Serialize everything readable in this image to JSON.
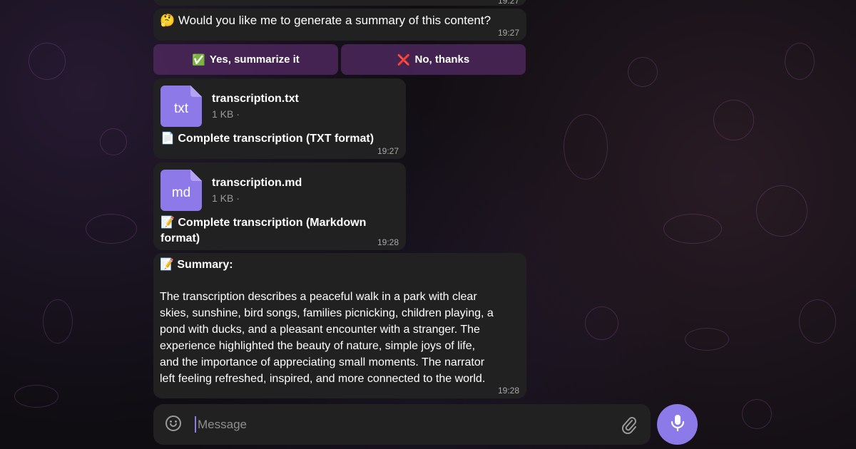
{
  "top_partial": {
    "time": "19:27"
  },
  "question": {
    "emoji": "🤔",
    "text": "Would you like me to generate a summary of this content?",
    "time": "19:27"
  },
  "buttons": {
    "yes": {
      "emoji": "✅",
      "label": "Yes, summarize it"
    },
    "no": {
      "emoji": "❌",
      "label": "No, thanks"
    }
  },
  "files": [
    {
      "ext": "txt",
      "name": "transcription.txt",
      "size": "1 KB ·",
      "caption_emoji": "📄",
      "caption": "Complete transcription (TXT format)",
      "time": "19:27"
    },
    {
      "ext": "md",
      "name": "transcription.md",
      "size": "1 KB ·",
      "caption_emoji": "📝",
      "caption_line1": "Complete transcription (Markdown",
      "caption_line2": "format)",
      "time": "19:28"
    }
  ],
  "summary": {
    "emoji": "📝",
    "heading": "Summary:",
    "lines": [
      "The transcription describes a peaceful walk in a park with clear",
      "skies, sunshine, bird songs, families picnicking, children playing, a",
      "pond with ducks, and a pleasant encounter with a stranger. The",
      "experience highlighted the beauty of nature, simple joys of life,",
      "and the importance of appreciating small moments. The narrator",
      "left feeling refreshed, inspired, and more connected to the world."
    ],
    "time": "19:28"
  },
  "composer": {
    "placeholder": "Message"
  },
  "icons": {
    "emoji": "emoji-icon",
    "attach": "paperclip-icon",
    "mic": "microphone-icon"
  },
  "colors": {
    "accent": "#8b7ae8",
    "bubble": "#212121",
    "button": "#4c275c"
  }
}
